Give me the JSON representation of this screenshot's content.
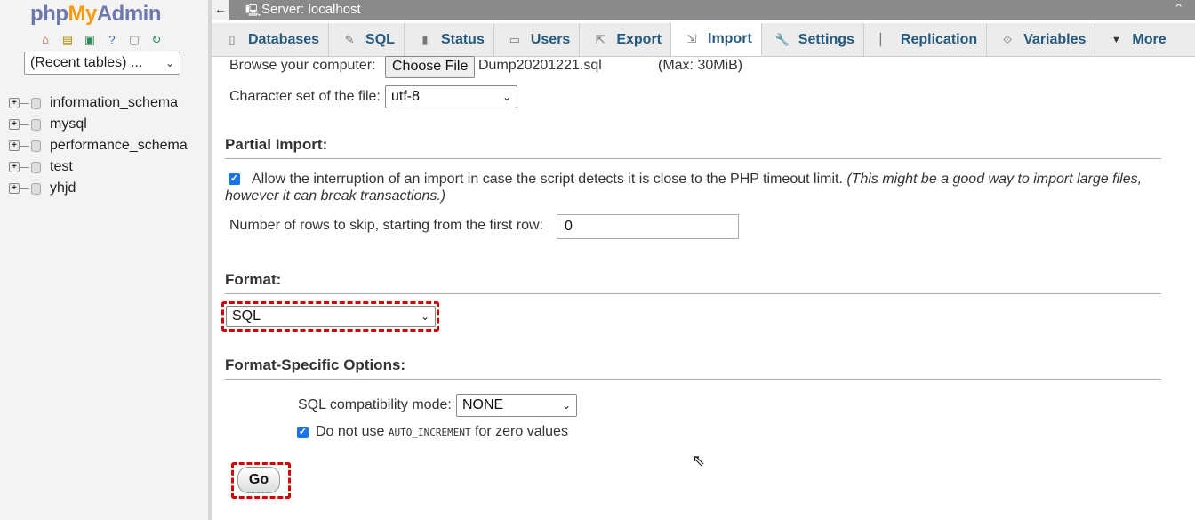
{
  "nav": {
    "logo": {
      "php": "php",
      "my": "My",
      "admin": "Admin"
    },
    "icons": [
      "home-icon",
      "exit-icon",
      "sql-query-icon",
      "help-icon",
      "docs-icon",
      "reload-icon"
    ],
    "recent_tables": "(Recent tables) ...",
    "databases": [
      {
        "name": "information_schema"
      },
      {
        "name": "mysql"
      },
      {
        "name": "performance_schema"
      },
      {
        "name": "test"
      },
      {
        "name": "yhjd"
      }
    ]
  },
  "topbar": {
    "back": "←",
    "title": "Server: localhost",
    "collapse": "⌃"
  },
  "tabs": [
    {
      "label": "Databases",
      "icon": "database-icon",
      "glyph": "▯"
    },
    {
      "label": "SQL",
      "icon": "sql-icon",
      "glyph": "✎"
    },
    {
      "label": "Status",
      "icon": "status-icon",
      "glyph": "▮"
    },
    {
      "label": "Users",
      "icon": "users-icon",
      "glyph": "▭"
    },
    {
      "label": "Export",
      "icon": "export-icon",
      "glyph": "⇱"
    },
    {
      "label": "Import",
      "icon": "import-icon",
      "glyph": "⇲"
    },
    {
      "label": "Settings",
      "icon": "wrench-icon",
      "glyph": "🔧"
    },
    {
      "label": "Replication",
      "icon": "replication-icon",
      "glyph": "▏"
    },
    {
      "label": "Variables",
      "icon": "variables-icon",
      "glyph": "⟐"
    },
    {
      "label": "More",
      "icon": "chevron-down-icon",
      "glyph": "▼"
    }
  ],
  "active_tab": "Import",
  "file": {
    "browse_label": "Browse your computer:",
    "choose_button": "Choose File",
    "filename": "Dump20201221.sql",
    "max_size": "(Max: 30MiB)",
    "charset_label": "Character set of the file:",
    "charset_value": "utf-8"
  },
  "partial_import": {
    "title": "Partial Import:",
    "allow_interrupt_label": "Allow the interruption of an import in case the script detects it is close to the PHP timeout limit.",
    "allow_interrupt_hint_1": "(This might be a good way to import large files,",
    "allow_interrupt_hint_2": "however it can break transactions.)",
    "allow_interrupt_checked": true,
    "skip_rows_label": "Number of rows to skip, starting from the first row:",
    "skip_rows_value": "0"
  },
  "format": {
    "title": "Format:",
    "value": "SQL"
  },
  "format_options": {
    "title": "Format-Specific Options:",
    "compat_label": "SQL compatibility mode:",
    "compat_value": "NONE",
    "no_auto_inc_prefix": "Do not use",
    "no_auto_inc_code": "AUTO_INCREMENT",
    "no_auto_inc_suffix": "for zero values",
    "no_auto_inc_checked": true
  },
  "go_button": "Go",
  "colors": {
    "accent_link": "#235a81",
    "highlight": "#d40000",
    "checkbox": "#1a73e8"
  }
}
